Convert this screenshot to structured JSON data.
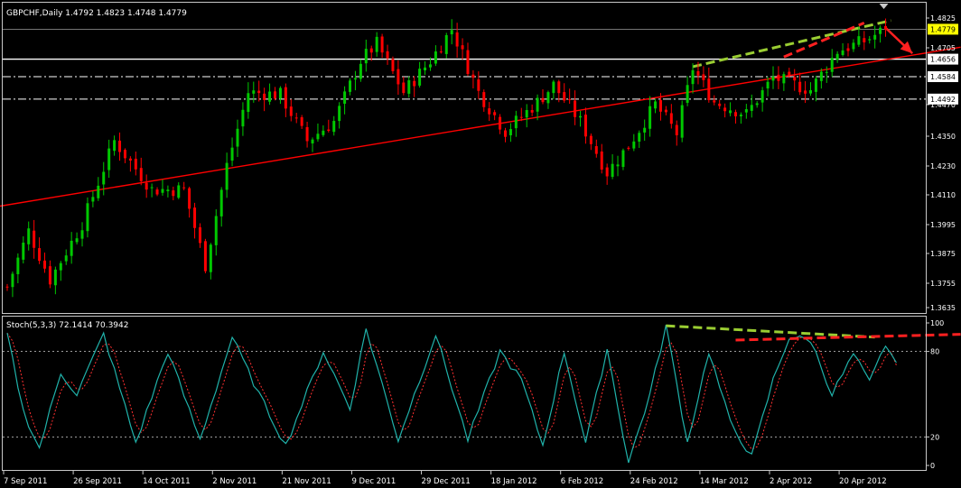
{
  "symbol_header": "GBPCHF,Daily  1.4792 1.4823 1.4748 1.4779",
  "stoch_header": "Stoch(5,3,3) 72.1414 70.3942",
  "colors": {
    "background": "#000000",
    "bull_candle": "#00c800",
    "bear_candle": "#ff0000",
    "frame": "#c8c8c8",
    "axis_text": "#ffffff",
    "trendline": "#ff0000",
    "pattern_top": "#9acd32",
    "pattern_bottom": "#ff2020",
    "stoch_main": "#20b2aa",
    "stoch_signal": "#ff3030",
    "current_price_box": "#ffff00"
  },
  "chart_data": [
    {
      "type": "candlestick",
      "title": "GBPCHF,Daily",
      "ohlc_last": {
        "open": 1.4792,
        "high": 1.4823,
        "low": 1.4748,
        "close": 1.4779
      },
      "ylim": [
        1.3635,
        1.4825
      ],
      "y_ticks": [
        "1.4825",
        "1.4705",
        "1.4470",
        "1.4350",
        "1.4230",
        "1.4110",
        "1.3995",
        "1.3875",
        "1.3755",
        "1.3635"
      ],
      "x_ticks": [
        "7 Sep 2011",
        "26 Sep 2011",
        "14 Oct 2011",
        "2 Nov 2011",
        "21 Nov 2011",
        "9 Dec 2011",
        "29 Dec 2011",
        "18 Jan 2012",
        "6 Feb 2012",
        "24 Feb 2012",
        "14 Mar 2012",
        "2 Apr 2012",
        "20 Apr 2012"
      ],
      "bars_between_ticks": 13,
      "levels": [
        {
          "label": "1.4779",
          "value": 1.4779,
          "style": "current"
        },
        {
          "label": "1.4656",
          "value": 1.4656,
          "style": "solid"
        },
        {
          "label": "1.4584",
          "value": 1.4584,
          "style": "dashdot"
        },
        {
          "label": "1.4492",
          "value": 1.4492,
          "style": "dashdot"
        }
      ],
      "anchors": [
        {
          "bar": 0,
          "close": 1.372
        },
        {
          "bar": 4,
          "close": 1.395
        },
        {
          "bar": 8,
          "close": 1.375
        },
        {
          "bar": 14,
          "close": 1.398
        },
        {
          "bar": 20,
          "close": 1.432
        },
        {
          "bar": 27,
          "close": 1.412
        },
        {
          "bar": 33,
          "close": 1.412
        },
        {
          "bar": 37,
          "close": 1.381
        },
        {
          "bar": 41,
          "close": 1.422
        },
        {
          "bar": 45,
          "close": 1.452
        },
        {
          "bar": 51,
          "close": 1.451
        },
        {
          "bar": 56,
          "close": 1.432
        },
        {
          "bar": 61,
          "close": 1.44
        },
        {
          "bar": 66,
          "close": 1.465
        },
        {
          "bar": 69,
          "close": 1.472
        },
        {
          "bar": 74,
          "close": 1.452
        },
        {
          "bar": 79,
          "close": 1.465
        },
        {
          "bar": 83,
          "close": 1.478
        },
        {
          "bar": 88,
          "close": 1.452
        },
        {
          "bar": 93,
          "close": 1.436
        },
        {
          "bar": 99,
          "close": 1.448
        },
        {
          "bar": 102,
          "close": 1.455
        },
        {
          "bar": 107,
          "close": 1.44
        },
        {
          "bar": 112,
          "close": 1.419
        },
        {
          "bar": 116,
          "close": 1.43
        },
        {
          "bar": 121,
          "close": 1.447
        },
        {
          "bar": 125,
          "close": 1.435
        },
        {
          "bar": 128,
          "close": 1.462
        },
        {
          "bar": 132,
          "close": 1.448
        },
        {
          "bar": 138,
          "close": 1.443
        },
        {
          "bar": 143,
          "close": 1.458
        },
        {
          "bar": 150,
          "close": 1.453
        },
        {
          "bar": 155,
          "close": 1.469
        },
        {
          "bar": 160,
          "close": 1.473
        },
        {
          "bar": 164,
          "close": 1.478
        }
      ],
      "annotations": [
        {
          "label": "support trendline",
          "from": [
            -17,
            1.3995
          ],
          "to": [
            178,
            1.4705
          ],
          "color": "#ff0000",
          "style": "solid"
        },
        {
          "label": "upper wedge line",
          "from": [
            128,
            1.4625
          ],
          "to": [
            165,
            1.4815
          ],
          "color": "#9acd32",
          "style": "dashed"
        },
        {
          "label": "lower wedge line",
          "from": [
            145,
            1.4665
          ],
          "to": [
            160,
            1.4805
          ],
          "color": "#ff2020",
          "style": "dashed"
        },
        {
          "label": "projection arrow",
          "from": [
            164,
            1.4785
          ],
          "to": [
            169,
            1.468
          ],
          "color": "#ff2020",
          "style": "arrow"
        }
      ]
    },
    {
      "type": "line",
      "title": "Stoch(5,3,3)",
      "main_last": 72.1414,
      "signal_last": 70.3942,
      "ylim": [
        0,
        100
      ],
      "y_ticks": [
        "100",
        "80",
        "20",
        "0"
      ],
      "levels": [
        80,
        20
      ],
      "anchors": [
        {
          "bar": 0,
          "v": 92
        },
        {
          "bar": 3,
          "v": 38
        },
        {
          "bar": 6,
          "v": 12
        },
        {
          "bar": 10,
          "v": 65
        },
        {
          "bar": 13,
          "v": 50
        },
        {
          "bar": 18,
          "v": 92
        },
        {
          "bar": 24,
          "v": 16
        },
        {
          "bar": 30,
          "v": 80
        },
        {
          "bar": 36,
          "v": 18
        },
        {
          "bar": 42,
          "v": 90
        },
        {
          "bar": 47,
          "v": 50
        },
        {
          "bar": 52,
          "v": 14
        },
        {
          "bar": 59,
          "v": 80
        },
        {
          "bar": 64,
          "v": 40
        },
        {
          "bar": 67,
          "v": 96
        },
        {
          "bar": 73,
          "v": 18
        },
        {
          "bar": 80,
          "v": 92
        },
        {
          "bar": 86,
          "v": 18
        },
        {
          "bar": 92,
          "v": 80
        },
        {
          "bar": 96,
          "v": 60
        },
        {
          "bar": 100,
          "v": 14
        },
        {
          "bar": 104,
          "v": 80
        },
        {
          "bar": 108,
          "v": 16
        },
        {
          "bar": 112,
          "v": 82
        },
        {
          "bar": 116,
          "v": 2
        },
        {
          "bar": 120,
          "v": 50
        },
        {
          "bar": 123,
          "v": 98
        },
        {
          "bar": 127,
          "v": 16
        },
        {
          "bar": 131,
          "v": 80
        },
        {
          "bar": 135,
          "v": 30
        },
        {
          "bar": 139,
          "v": 6
        },
        {
          "bar": 143,
          "v": 60
        },
        {
          "bar": 146,
          "v": 90
        },
        {
          "bar": 150,
          "v": 88
        },
        {
          "bar": 154,
          "v": 50
        },
        {
          "bar": 158,
          "v": 78
        },
        {
          "bar": 161,
          "v": 58
        },
        {
          "bar": 164,
          "v": 85
        },
        {
          "bar": 166,
          "v": 72
        }
      ],
      "annotations": [
        {
          "label": "stoch top line",
          "from": [
            123,
            98
          ],
          "to": [
            162,
            90
          ],
          "color": "#9acd32",
          "style": "dashed"
        },
        {
          "label": "stoch high line",
          "from": [
            136,
            88
          ],
          "to": [
            178,
            92
          ],
          "color": "#ff2020",
          "style": "dashed"
        }
      ]
    }
  ]
}
